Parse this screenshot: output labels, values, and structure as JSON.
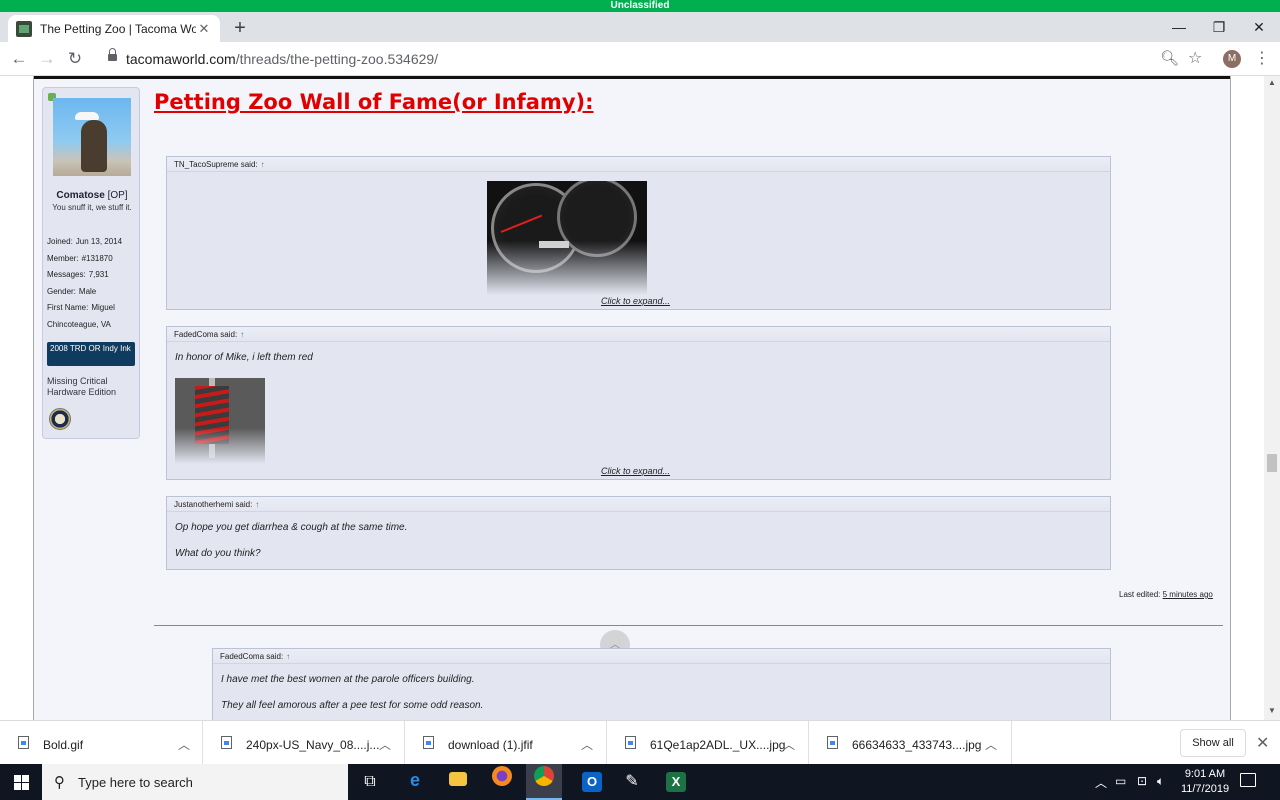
{
  "banner": {
    "text": "Unclassified"
  },
  "browser": {
    "tab_title": "The Petting Zoo | Tacoma World",
    "tab_close": "✕",
    "new_tab": "+",
    "url_host": "tacomaworld.com",
    "url_path": "/threads/the-petting-zoo.534629/",
    "avatar_letter": "M"
  },
  "user": {
    "name": "Comatose",
    "op_tag": "[OP]",
    "title": "You snuff it, we stuff it.",
    "stats": [
      {
        "label": "Joined:",
        "value": "Jun 13, 2014"
      },
      {
        "label": "Member:",
        "value": "#131870"
      },
      {
        "label": "Messages:",
        "value": "7,931"
      },
      {
        "label": "Gender:",
        "value": "Male"
      },
      {
        "label": "First Name:",
        "value": "Miguel"
      },
      {
        "label": "",
        "value": "Chincoteague, VA"
      }
    ],
    "truck": "2008 TRD OR Indy Ink",
    "edition": "Missing Critical Hardware Edition"
  },
  "post": {
    "title": "Petting Zoo Wall of Fame(or Infamy):",
    "quotes": [
      {
        "author": "TN_TacoSupreme",
        "said": "said:",
        "arrow": "↑",
        "expand": "Click to expand..."
      },
      {
        "author": "FadedComa",
        "said": "said:",
        "arrow": "↑",
        "text": "In honor of Mike, i left them red",
        "expand": "Click to expand..."
      },
      {
        "author": "Justanotherhemi",
        "said": "said:",
        "arrow": "↑",
        "line1": "Op hope you get diarrhea & cough at the same time.",
        "line2": "What do you think?"
      }
    ],
    "last_edited_label": "Last edited:",
    "last_edited_value": "5 minutes ago"
  },
  "next_post": {
    "author": "FadedComa",
    "said": "said:",
    "arrow": "↑",
    "line1": "I have met the best women at the parole officers building.",
    "line2": "They all feel amorous after a pee test for some odd reason."
  },
  "downloads": {
    "items": [
      "Bold.gif",
      "240px-US_Navy_08....j...",
      "download (1).jfif",
      "61Qe1ap2ADL._UX....jpg",
      "66634633_433743....jpg"
    ],
    "show_all": "Show all"
  },
  "taskbar": {
    "search_placeholder": "Type here to search",
    "time": "9:01 AM",
    "date": "11/7/2019"
  }
}
